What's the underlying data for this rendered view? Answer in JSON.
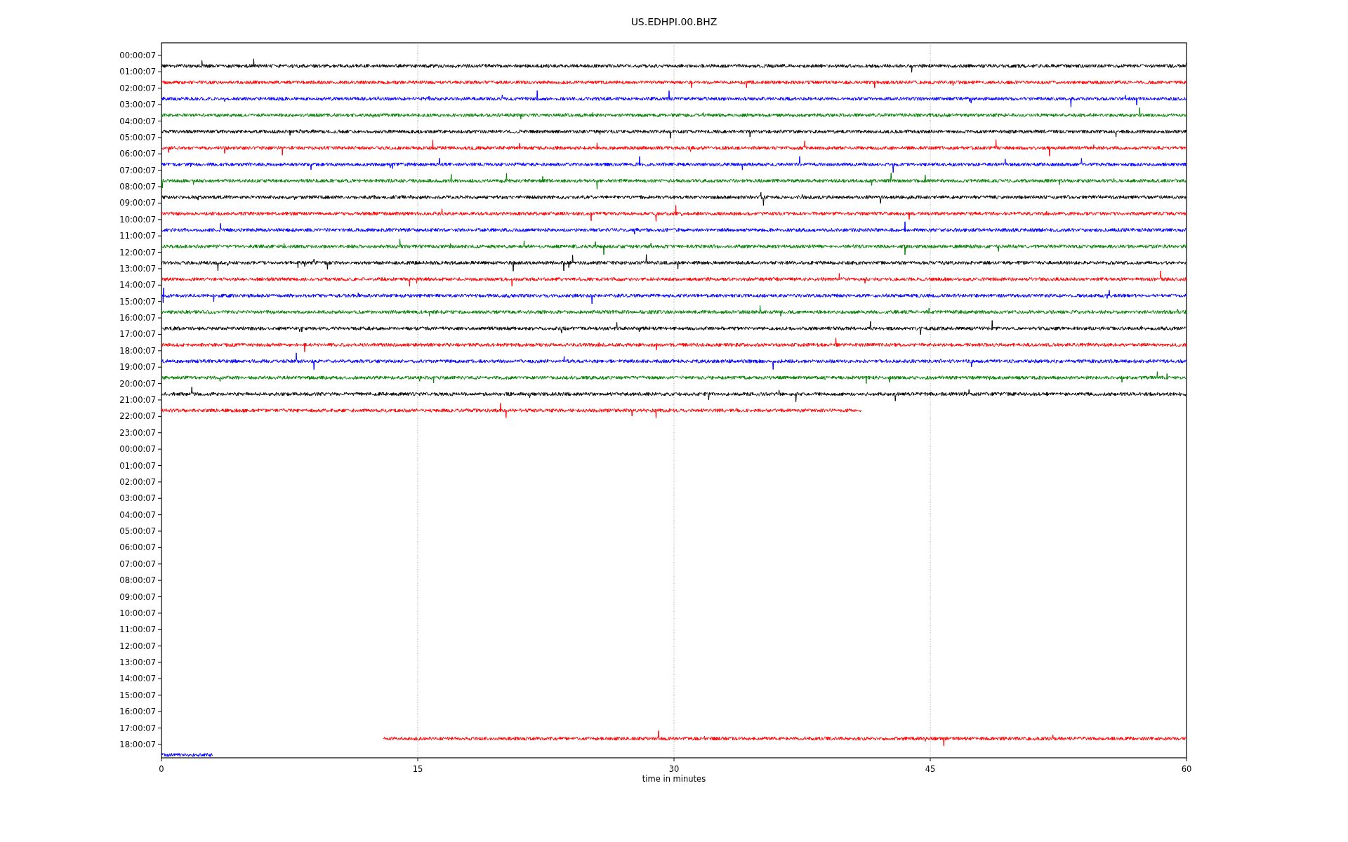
{
  "title": "US.EDHPI.00.BHZ",
  "rows": [
    {
      "label": "00:00:07",
      "trace": {
        "color": "#000000"
      }
    },
    {
      "label": "01:00:07",
      "trace": {
        "color": "#ff0000"
      }
    },
    {
      "label": "02:00:07",
      "trace": {
        "color": "#0000ff"
      }
    },
    {
      "label": "03:00:07",
      "trace": {
        "color": "#008000"
      }
    },
    {
      "label": "04:00:07",
      "trace": {
        "color": "#000000"
      }
    },
    {
      "label": "05:00:07",
      "trace": {
        "color": "#ff0000"
      }
    },
    {
      "label": "06:00:07",
      "trace": {
        "color": "#0000ff"
      }
    },
    {
      "label": "07:00:07",
      "trace": {
        "color": "#008000"
      }
    },
    {
      "label": "08:00:07",
      "trace": {
        "color": "#000000"
      }
    },
    {
      "label": "09:00:07",
      "trace": {
        "color": "#ff0000"
      }
    },
    {
      "label": "10:00:07",
      "trace": {
        "color": "#0000ff"
      }
    },
    {
      "label": "11:00:07",
      "trace": {
        "color": "#008000"
      }
    },
    {
      "label": "12:00:07",
      "trace": {
        "color": "#000000"
      }
    },
    {
      "label": "13:00:07",
      "trace": {
        "color": "#ff0000"
      }
    },
    {
      "label": "14:00:07",
      "trace": {
        "color": "#0000ff"
      }
    },
    {
      "label": "15:00:07",
      "trace": {
        "color": "#008000"
      }
    },
    {
      "label": "16:00:07",
      "trace": {
        "color": "#000000"
      }
    },
    {
      "label": "17:00:07",
      "trace": {
        "color": "#ff0000"
      }
    },
    {
      "label": "18:00:07",
      "trace": {
        "color": "#0000ff"
      }
    },
    {
      "label": "19:00:07",
      "trace": {
        "color": "#008000"
      }
    },
    {
      "label": "20:00:07",
      "trace": {
        "color": "#000000"
      }
    },
    {
      "label": "21:00:07",
      "trace": {
        "color": "#ff0000"
      }
    },
    {
      "label": "22:00:07"
    },
    {
      "label": "23:00:07"
    },
    {
      "label": "00:00:07"
    },
    {
      "label": "01:00:07"
    },
    {
      "label": "02:00:07"
    },
    {
      "label": "03:00:07"
    },
    {
      "label": "04:00:07"
    },
    {
      "label": "05:00:07"
    },
    {
      "label": "06:00:07"
    },
    {
      "label": "07:00:07"
    },
    {
      "label": "08:00:07"
    },
    {
      "label": "09:00:07"
    },
    {
      "label": "10:00:07"
    },
    {
      "label": "11:00:07"
    },
    {
      "label": "12:00:07"
    },
    {
      "label": "13:00:07"
    },
    {
      "label": "14:00:07"
    },
    {
      "label": "15:00:07"
    },
    {
      "label": "16:00:07"
    },
    {
      "label": "17:00:07",
      "trace": {
        "color": "#ff0000"
      }
    },
    {
      "label": "18:00:07",
      "trace": {
        "color": "#0000ff"
      }
    }
  ],
  "xticks": [
    "0",
    "15",
    "30",
    "45",
    "60"
  ],
  "xlabel": "time in minutes"
}
